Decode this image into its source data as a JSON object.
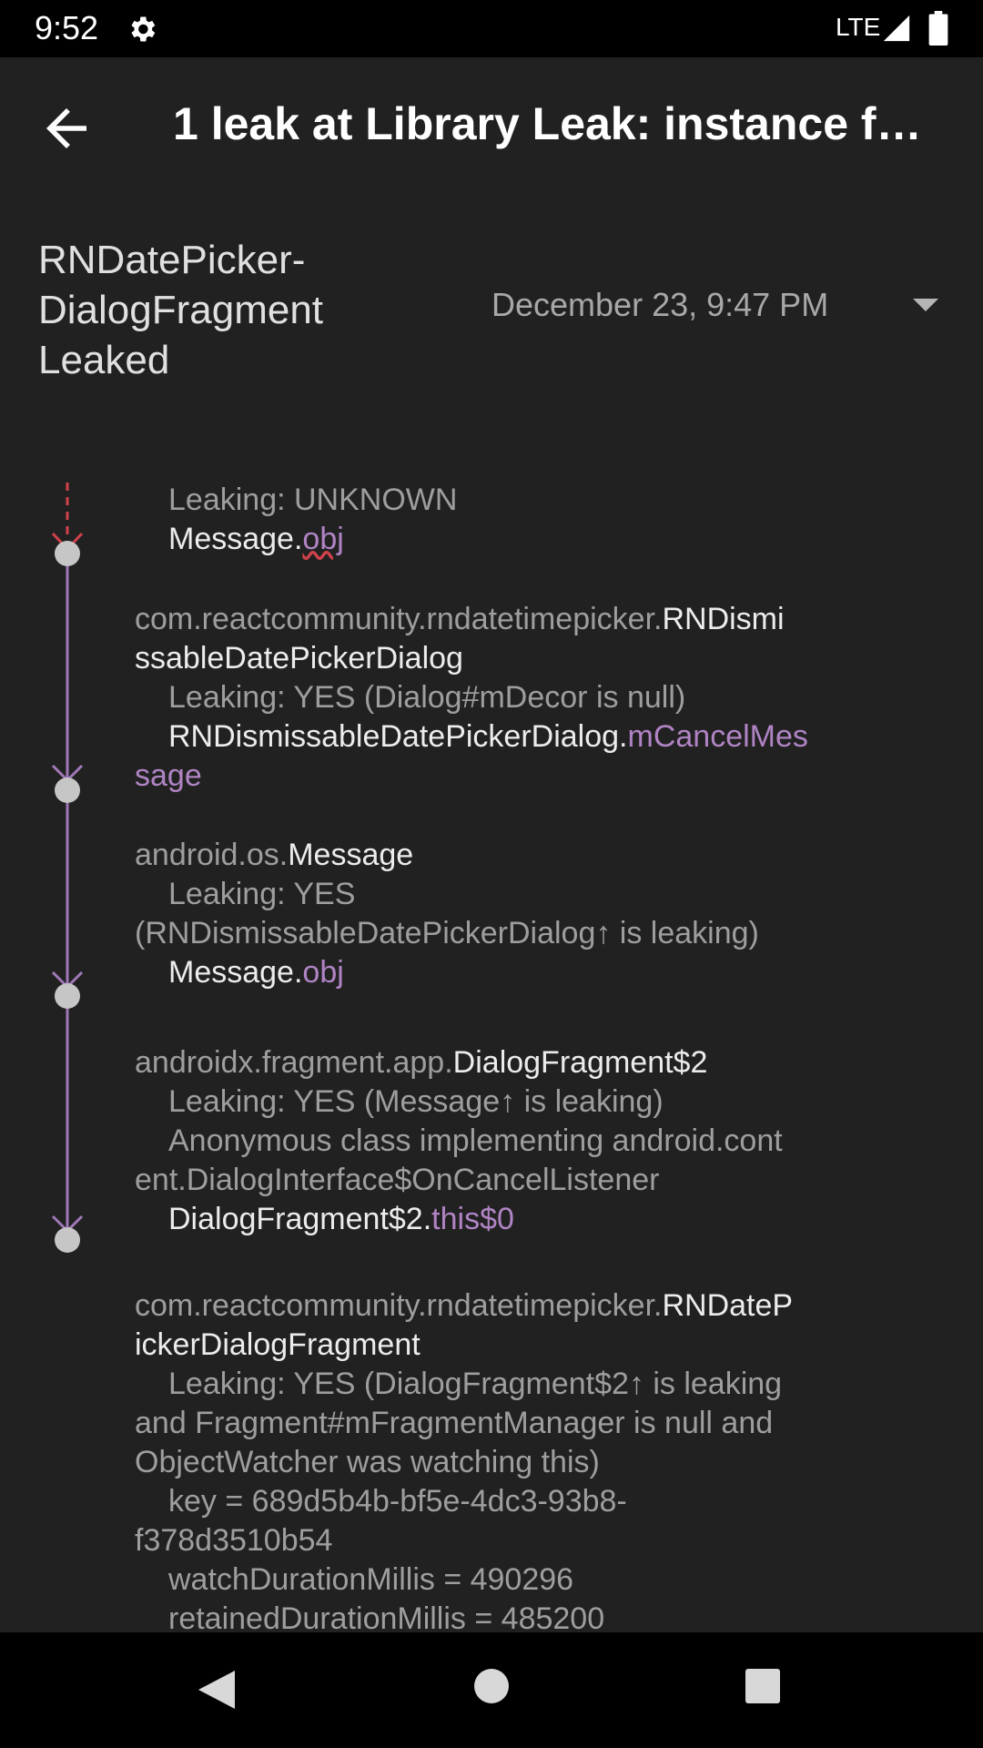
{
  "status_bar": {
    "time": "9:52",
    "network": "LTE",
    "icons": [
      "gear-icon",
      "signal-icon",
      "battery-icon"
    ]
  },
  "toolbar": {
    "title": "1 leak at Library Leak: instance fi…",
    "back_icon": "arrow-back-icon"
  },
  "leak_header": {
    "title_lines": [
      "RNDatePicker-",
      "DialogFragment",
      "Leaked"
    ],
    "date": "December 23, 9:47 PM",
    "expand_icon": "dropdown-icon"
  },
  "trace": {
    "first": {
      "leaking": "Leaking: UNKNOWN",
      "ref_class": "Message.",
      "ref_field": "obj"
    },
    "nodes": [
      {
        "pkg_line1": "com.reactcommunity.rndatetimepicker.",
        "cls_line1": "RNDismi",
        "cls_line2": "ssableDatePickerDialog",
        "leaking": "Leaking: YES (Dialog#mDecor is null)",
        "ref_class": "RNDismissableDatePickerDialog.",
        "ref_field_line1": "mCancelMes",
        "ref_field_line2": "sage"
      },
      {
        "pkg": "android.os.",
        "cls": "Message",
        "leaking_line1": "Leaking: YES",
        "leaking_line2": "(RNDismissableDatePickerDialog↑ is leaking)",
        "ref_class": "Message.",
        "ref_field": "obj"
      },
      {
        "pkg": "androidx.fragment.app.",
        "cls": "DialogFragment$2",
        "leaking": "Leaking: YES (Message↑ is leaking)",
        "desc_line1": "Anonymous class implementing android.cont",
        "desc_line2": "ent.DialogInterface$OnCancelListener",
        "ref_class": "DialogFragment$2.",
        "ref_field": "this$0"
      },
      {
        "pkg_line1": "com.reactcommunity.rndatetimepicker.",
        "cls_line1": "RNDateP",
        "cls_line2": "ickerDialogFragment",
        "leaking_line1": "Leaking: YES (DialogFragment$2↑ is leaking",
        "leaking_line2": "and Fragment#mFragmentManager is null and",
        "leaking_line3": "ObjectWatcher was watching this)",
        "key_line1": "key = 689d5b4b-bf5e-4dc3-93b8-",
        "key_line2": "f378d3510b54",
        "watch": "watchDurationMillis = 490296",
        "retained": "retainedDurationMillis = 485200"
      }
    ]
  },
  "nav_bar": {
    "icons": [
      "nav-back-icon",
      "nav-home-icon",
      "nav-recents-icon"
    ]
  },
  "colors": {
    "background": "#212121",
    "primary_text": "#ececec",
    "secondary_text": "#9e9e9e",
    "reference": "#b084c4",
    "leak_line": "#d0414b",
    "trace_line": "#a078b8"
  }
}
